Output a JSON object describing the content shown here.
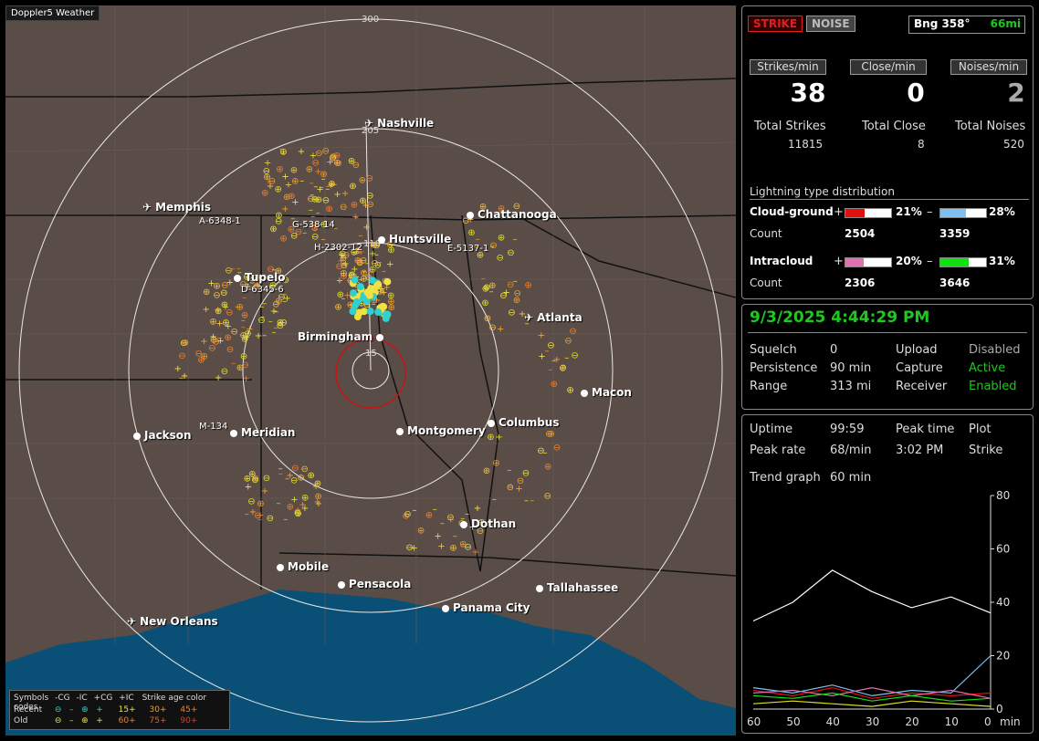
{
  "map": {
    "brand": "Doppler5 Weather",
    "ring_labels": [
      "300",
      "205",
      "110",
      "15"
    ],
    "cities": [
      {
        "name": "Nashville",
        "type": "airport"
      },
      {
        "name": "Memphis",
        "type": "airport"
      },
      {
        "name": "Chattanooga",
        "type": "city"
      },
      {
        "name": "Huntsville",
        "type": "city"
      },
      {
        "name": "Tupelo",
        "type": "city"
      },
      {
        "name": "Birmingham",
        "type": "city"
      },
      {
        "name": "Atlanta",
        "type": "airport"
      },
      {
        "name": "Macon",
        "type": "city"
      },
      {
        "name": "Jackson",
        "type": "city"
      },
      {
        "name": "Meridian",
        "type": "city"
      },
      {
        "name": "Montgomery",
        "type": "city"
      },
      {
        "name": "Columbus",
        "type": "city"
      },
      {
        "name": "Dothan",
        "type": "city"
      },
      {
        "name": "Mobile",
        "type": "city"
      },
      {
        "name": "Pensacola",
        "type": "city"
      },
      {
        "name": "Tallahassee",
        "type": "city"
      },
      {
        "name": "Panama City",
        "type": "city"
      },
      {
        "name": "New Orleans",
        "type": "airport"
      }
    ],
    "storm_labels": [
      "A-6348-1",
      "G-538-14",
      "H-2302-12",
      "E-5137-1",
      "D-6345-6",
      "M-134"
    ],
    "legend": {
      "symbols_label": "Symbols",
      "recent_label": "Recent",
      "old_label": "Old",
      "headers": [
        "-CG",
        "-IC",
        "+CG",
        "+IC"
      ],
      "age_title": "Strike age color codes",
      "recent_ages": [
        "15+",
        "30+",
        "45+"
      ],
      "old_ages": [
        "60+",
        "75+",
        "90+"
      ]
    }
  },
  "status": {
    "strike_btn": "STRIKE",
    "noise_btn": "NOISE",
    "bearing": "Bng 358°",
    "distance": "66mi",
    "strikes_min_label": "Strikes/min",
    "close_min_label": "Close/min",
    "noises_min_label": "Noises/min",
    "strikes_min": "38",
    "close_min": "0",
    "noises_min": "2",
    "total_strikes_label": "Total Strikes",
    "total_close_label": "Total Close",
    "total_noises_label": "Total Noises",
    "total_strikes": "11815",
    "total_close": "8",
    "total_noises": "520",
    "dist_title": "Lightning type distribution",
    "cg_label": "Cloud-ground",
    "ic_label": "Intracloud",
    "count_label": "Count",
    "plus": "+",
    "minus": "–",
    "cg_pos_pct": "21%",
    "cg_neg_pct": "28%",
    "ic_pos_pct": "20%",
    "ic_neg_pct": "31%",
    "cg_pos_count": "2504",
    "cg_neg_count": "3359",
    "ic_pos_count": "2306",
    "ic_neg_count": "3646",
    "bar_levels": {
      "cg_pos": 0.21,
      "cg_neg": 0.28,
      "ic_pos": 0.2,
      "ic_neg": 0.31
    },
    "colors": {
      "cg_pos": "#e01010",
      "cg_neg": "#80c0f0",
      "ic_pos": "#e070b0",
      "ic_neg": "#10e010"
    }
  },
  "info": {
    "datetime": "9/3/2025 4:44:29 PM",
    "squelch_label": "Squelch",
    "squelch": "0",
    "persistence_label": "Persistence",
    "persistence": "90 min",
    "range_label": "Range",
    "range": "313 mi",
    "upload_label": "Upload",
    "upload": "Disabled",
    "capture_label": "Capture",
    "capture": "Active",
    "receiver_label": "Receiver",
    "receiver": "Enabled"
  },
  "trend": {
    "uptime_label": "Uptime",
    "uptime": "99:59",
    "peak_time_label": "Peak time",
    "plot_label": "Plot",
    "peak_rate_label": "Peak rate",
    "peak_rate": "68/min",
    "peak_time": "3:02 PM",
    "plot": "Strike",
    "trend_label": "Trend graph",
    "trend_value": "60 min",
    "y_ticks": [
      "80",
      "60",
      "40",
      "20",
      "0"
    ],
    "x_ticks": [
      "60",
      "50",
      "40",
      "30",
      "20",
      "10",
      "0"
    ],
    "x_unit": "min"
  },
  "chart_data": {
    "type": "line",
    "x": [
      60,
      50,
      40,
      30,
      20,
      10,
      0
    ],
    "ylim": [
      0,
      80
    ],
    "xlabel": "min",
    "series": [
      {
        "values": [
          33,
          40,
          52,
          44,
          38,
          42,
          36
        ],
        "color": "#ffffff"
      },
      {
        "values": [
          8,
          6,
          9,
          5,
          7,
          6,
          20
        ],
        "color": "#80c0f0"
      },
      {
        "values": [
          7,
          5,
          8,
          4,
          6,
          5,
          6
        ],
        "color": "#e01010"
      },
      {
        "values": [
          6,
          7,
          5,
          8,
          5,
          7,
          4
        ],
        "color": "#e070b0"
      },
      {
        "values": [
          5,
          4,
          6,
          3,
          5,
          3,
          4
        ],
        "color": "#10e010"
      },
      {
        "values": [
          2,
          3,
          2,
          1,
          3,
          2,
          1
        ],
        "color": "#e0e020"
      }
    ]
  }
}
